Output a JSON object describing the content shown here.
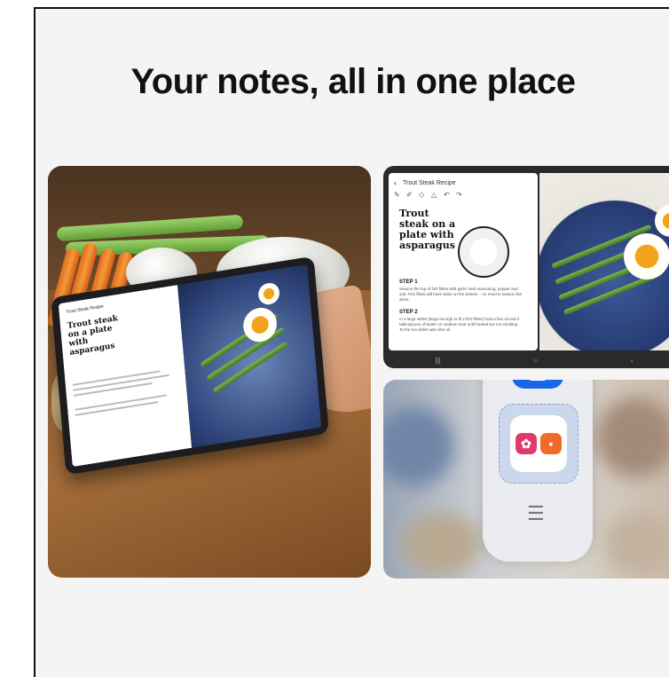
{
  "headline": "Your notes, all in one place",
  "tablet_left": {
    "recipe_title": "Trout steak on a plate with asparagus",
    "app_title": "Trout Steak Recipe"
  },
  "tablet_right": {
    "app_title": "Trout Steak Recipe",
    "recipe_title": "Trout steak on a plate with asparagus",
    "step1_label": "STEP 1",
    "step1_text": "Season the top of fish fillets with garlic herb seasoning, pepper and salt. Fish fillets will have skins on the bottom. - no need to season the skins.",
    "step2_label": "STEP 2",
    "step2_text": "In a large skillet (large enough to fit 2 fish fillets) heat a few oil and 2 tablespoons of butter on medium heat until heated but not smoking. To the hot skillet add olive oil.",
    "nav": [
      "|||",
      "○",
      "‹"
    ],
    "pen_colors": [
      "#8a4fd8",
      "#e0397b",
      "#1fa98b",
      "#2d8a3a",
      "#e23a3a",
      "#3a6fe2",
      "#8b8b8b"
    ]
  },
  "edge_panel": {
    "video_app": "video-camera-icon",
    "pair_apps": [
      "flower-app-icon",
      "notes-app-icon"
    ],
    "menu_glyph": "☰"
  },
  "colors": {
    "background": "#f4f4f4",
    "headline": "#111111",
    "video_blue": "#1a66e8",
    "flower_pink": "#e0396b",
    "notes_orange": "#f26a2a"
  }
}
